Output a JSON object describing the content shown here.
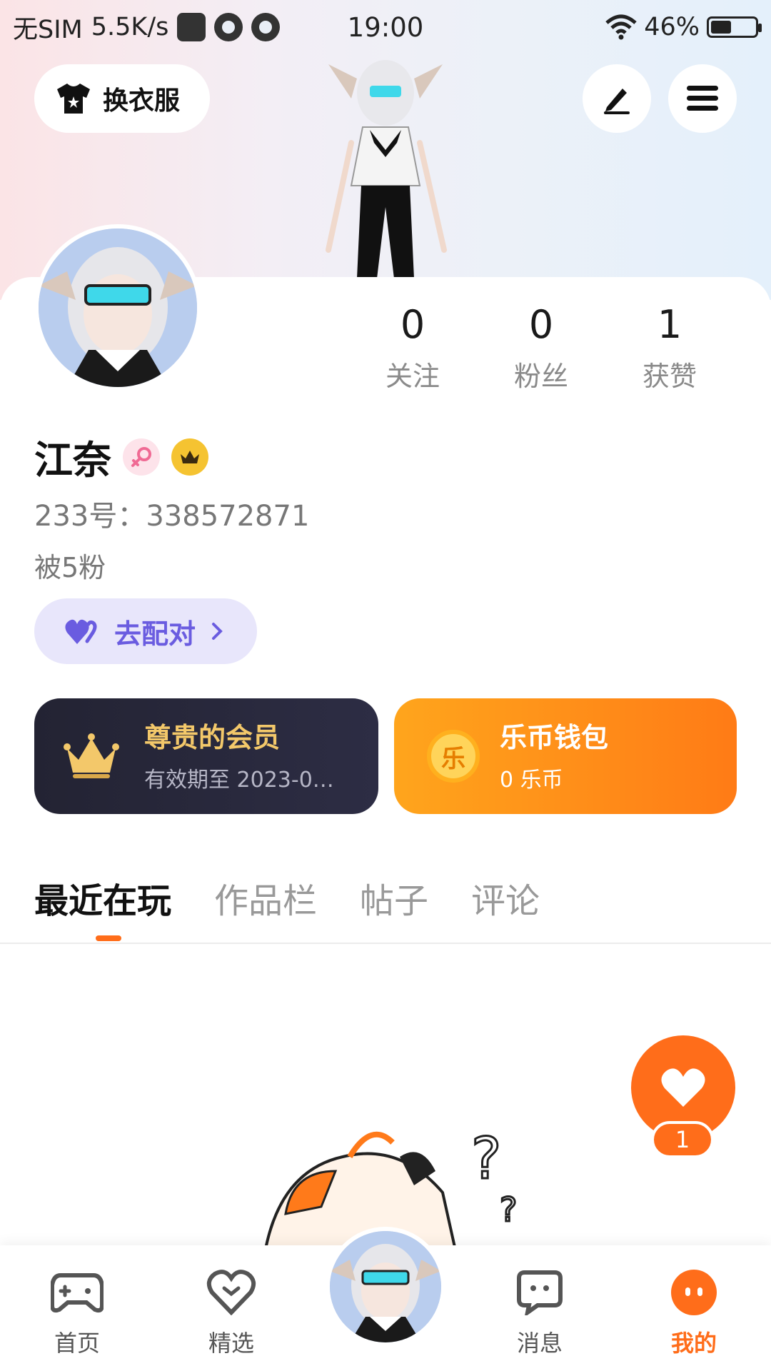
{
  "status_bar": {
    "carrier": "无SIM",
    "speed": "5.5K/s",
    "time": "19:00",
    "battery": "46%",
    "battery_level": 0.46
  },
  "header": {
    "outfit_label": "换衣服",
    "edit_icon": "pen-icon",
    "menu_icon": "menu-icon"
  },
  "stats": [
    {
      "value": "0",
      "label": "关注"
    },
    {
      "value": "0",
      "label": "粉丝"
    },
    {
      "value": "1",
      "label": "获赞"
    }
  ],
  "profile": {
    "name": "江奈",
    "user_id": "233号：338572871",
    "followed_by": "被5粉"
  },
  "match_button": {
    "label": "去配对"
  },
  "member_card": {
    "title": "尊贵的会员",
    "subtitle": "有效期至 2023-0…"
  },
  "wallet_card": {
    "title": "乐币钱包",
    "subtitle": "0 乐币",
    "coin_glyph": "乐"
  },
  "tabs": [
    "最近在玩",
    "作品栏",
    "帖子",
    "评论"
  ],
  "like": {
    "count": "1"
  },
  "nav": [
    {
      "label": "首页",
      "icon": "gamepad-icon"
    },
    {
      "label": "精选",
      "icon": "heart-badge-icon"
    },
    {
      "label": "消息",
      "icon": "chat-icon"
    },
    {
      "label": "我的",
      "icon": "profile-face-icon"
    }
  ],
  "colors": {
    "accent": "#ff6d1a",
    "match_purple": "#6a5ce0",
    "member_gold": "#f3c86a"
  }
}
